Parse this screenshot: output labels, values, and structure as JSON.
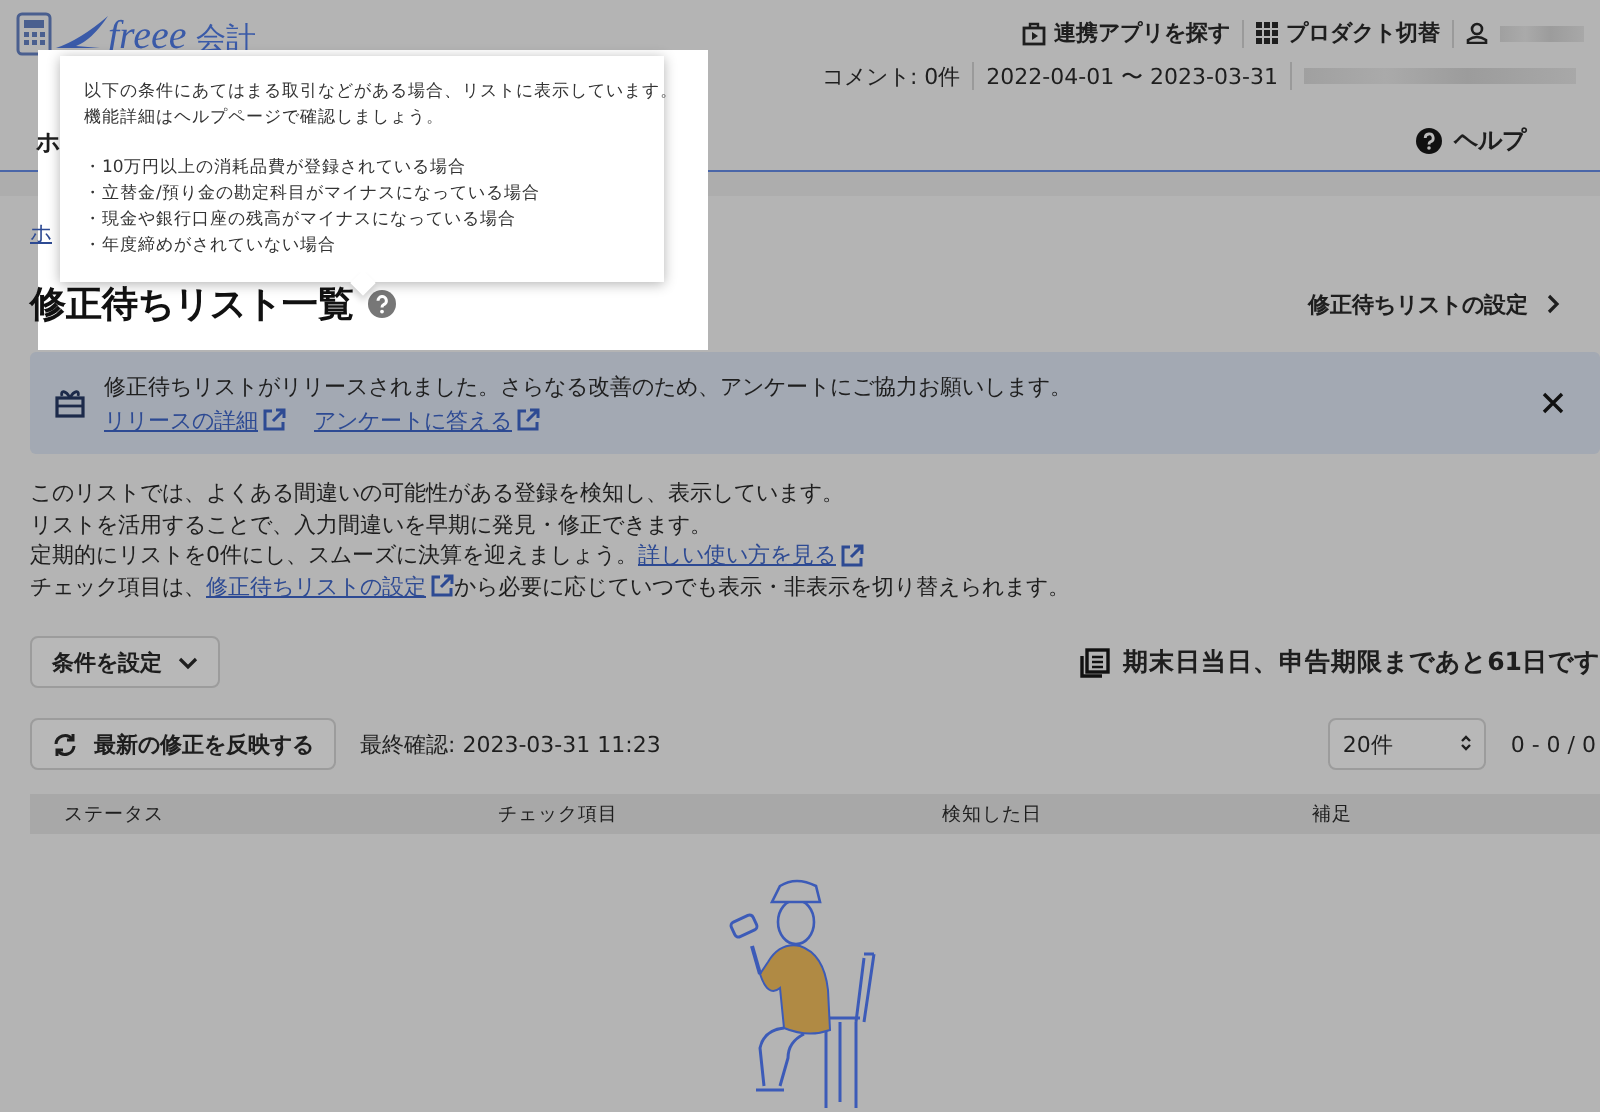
{
  "header": {
    "logo": "freee",
    "product": "会計",
    "links": [
      {
        "label": "連携アプリを探す",
        "kind": "apps"
      },
      {
        "label": "プロダクト切替",
        "kind": "grid"
      }
    ],
    "comments": "コメント: 0件",
    "period": "2022-04-01 〜 2023-03-31"
  },
  "nav": {
    "items": [
      {
        "label": "ホ"
      }
    ],
    "help": "ヘルプ"
  },
  "breadcrumb": "ホ",
  "page": {
    "title": "修正待ちリスト一覧",
    "settings_link": "修正待ちリストの設定"
  },
  "tooltip": {
    "lines": [
      "以下の条件にあてはまる取引などがある場合、リストに表示しています。",
      "機能詳細はヘルプページで確認しましょう。"
    ],
    "bullets": [
      "・10万円以上の消耗品費が登録されている場合",
      "・立替金/預り金の勘定科目がマイナスになっている場合",
      "・現金や銀行口座の残高がマイナスになっている場合",
      "・年度締めがされていない場合"
    ]
  },
  "banner": {
    "message": "修正待ちリストがリリースされました。さらなる改善のため、アンケートにご協力お願いします。",
    "links": [
      "リリースの詳細",
      "アンケートに答える"
    ]
  },
  "description": [
    [
      {
        "kind": "text",
        "text": "このリストでは、よくある間違いの可能性がある登録を検知し、表示しています。"
      }
    ],
    [
      {
        "kind": "text",
        "text": "リストを活用することで、入力間違いを早期に発見・修正できます。"
      }
    ],
    [
      {
        "kind": "text",
        "text": "定期的にリストを0件にし、スムーズに決算を迎えましょう。"
      },
      {
        "kind": "link",
        "text": "詳しい使い方を見る"
      }
    ],
    [
      {
        "kind": "text",
        "text": "チェック項目は、"
      },
      {
        "kind": "link",
        "text": "修正待ちリストの設定"
      },
      {
        "kind": "text",
        "text": "から必要に応じていつでも表示・非表示を切り替えられます。"
      }
    ]
  ],
  "filter_button": "条件を設定",
  "deadline": "期末日当日、申告期限まであと61日です",
  "refresh_button": "最新の修正を反映する",
  "last_checked": "最終確認: 2023-03-31 11:23",
  "page_size": "20件",
  "range": "0 - 0 / 0",
  "table": {
    "columns": [
      "ステータス",
      "チェック項目",
      "検知した日",
      "補足"
    ]
  }
}
